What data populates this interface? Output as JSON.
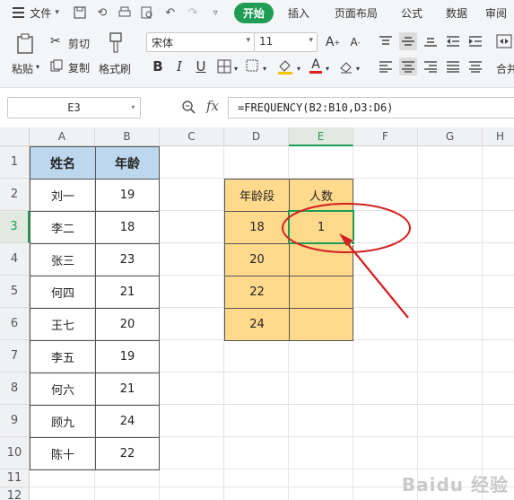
{
  "menu": {
    "file_label": "文件",
    "tabs": [
      "开始",
      "插入",
      "页面布局",
      "公式",
      "数据",
      "审阅"
    ]
  },
  "ribbon": {
    "paste": "粘贴",
    "cut": "剪切",
    "copy": "复制",
    "format_painter": "格式刷",
    "font_name": "宋体",
    "font_size": "11",
    "merge": "合并"
  },
  "formula_bar": {
    "name_box": "E3",
    "fx": "fx",
    "formula": "=FREQUENCY(B2:B10,D3:D6)"
  },
  "columns": [
    "A",
    "B",
    "C",
    "D",
    "E",
    "F",
    "G",
    "H"
  ],
  "rows": [
    "1",
    "2",
    "3",
    "4",
    "5",
    "6",
    "7",
    "8",
    "9",
    "10",
    "11",
    "12"
  ],
  "table_a": {
    "header_name": "姓名",
    "header_age": "年龄",
    "names": [
      "刘一",
      "李二",
      "张三",
      "何四",
      "王七",
      "李五",
      "何六",
      "顾九",
      "陈十"
    ],
    "ages": [
      "19",
      "18",
      "23",
      "21",
      "20",
      "19",
      "21",
      "24",
      "22"
    ]
  },
  "table_d": {
    "header_range": "年龄段",
    "header_count": "人数",
    "ranges": [
      "18",
      "20",
      "22",
      "24"
    ],
    "counts": [
      "1",
      "",
      "",
      ""
    ]
  },
  "colors": {
    "accent": "#1f9d55",
    "header_blue": "#bdd7ee",
    "yellow": "#ffd98c",
    "annotation_red": "#d32020"
  },
  "watermark": "Baidu 经验"
}
